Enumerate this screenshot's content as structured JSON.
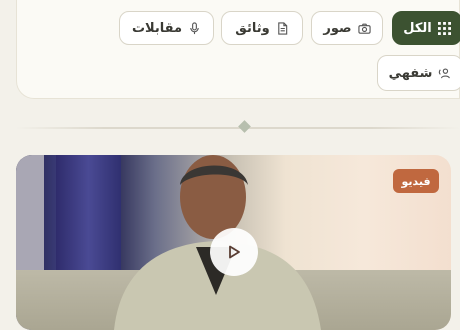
{
  "filters": [
    {
      "label": "الكل",
      "icon": "grid-icon",
      "active": true
    },
    {
      "label": "صور",
      "icon": "camera-icon",
      "active": false
    },
    {
      "label": "وثائق",
      "icon": "document-icon",
      "active": false
    },
    {
      "label": "مقابلات",
      "icon": "microphone-icon",
      "active": false
    },
    {
      "label": "شفهي",
      "icon": "oral-history-icon",
      "active": false
    }
  ],
  "media_card": {
    "badge": "فيديو"
  },
  "colors": {
    "accent": "#3c5231",
    "badge": "#c0683f",
    "background": "#f3f1ea"
  }
}
